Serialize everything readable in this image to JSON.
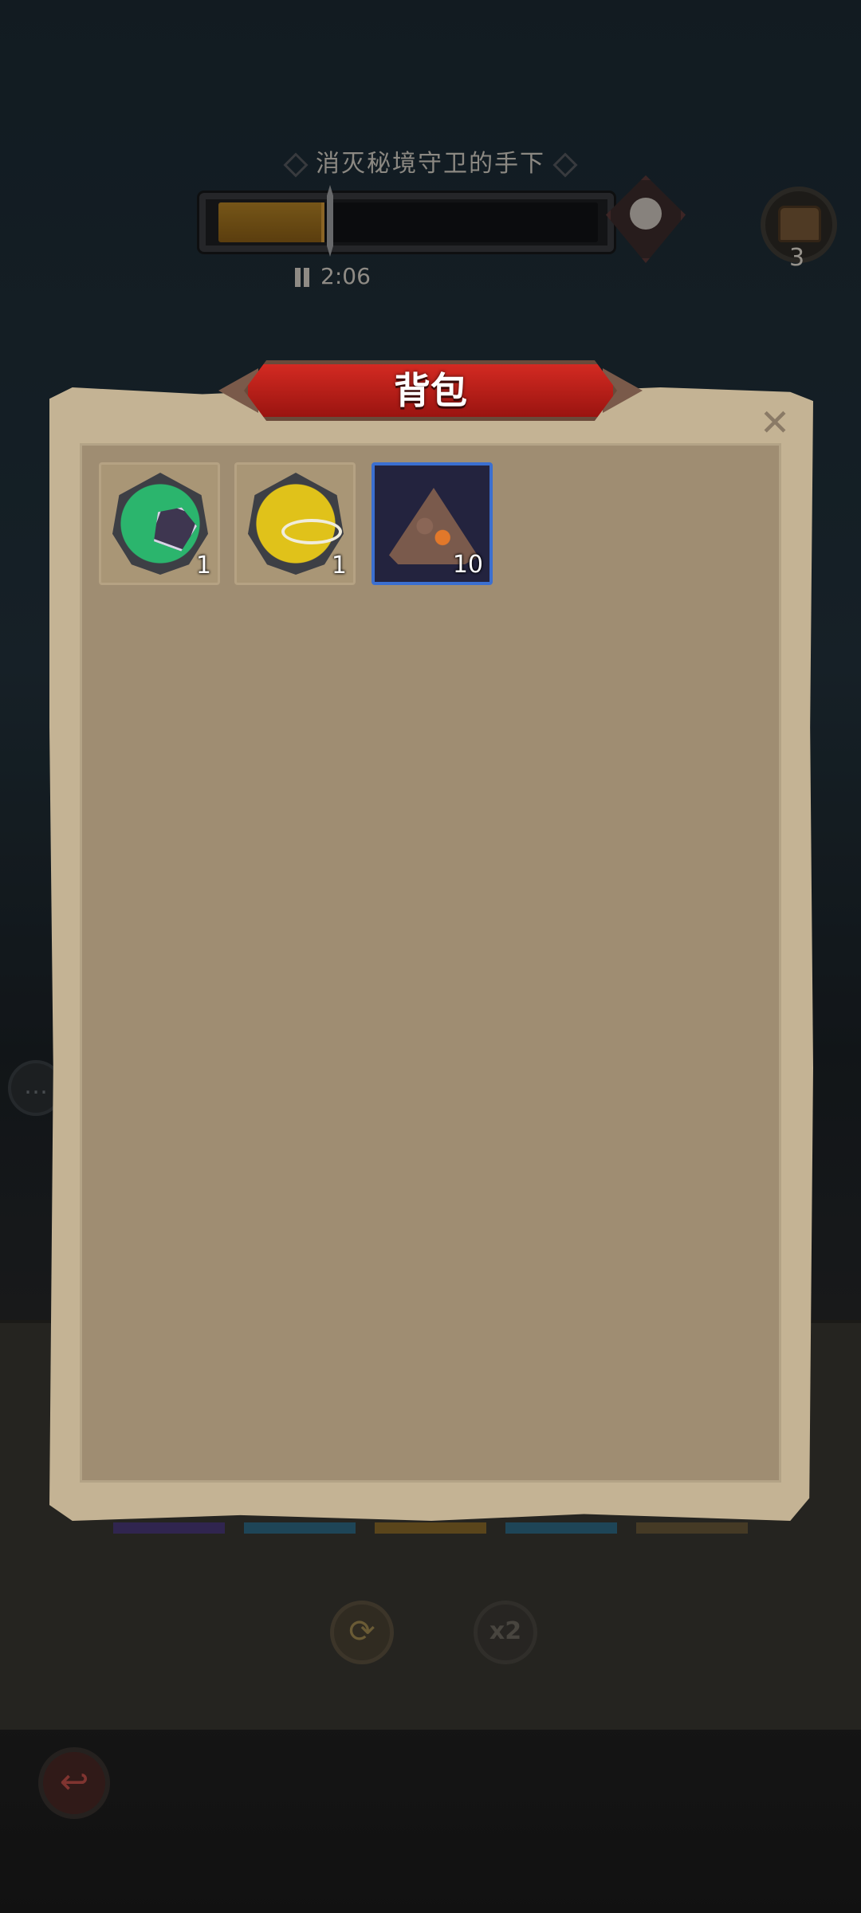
{
  "hud": {
    "objective": "消灭秘境守卫的手下",
    "progress": 0.27,
    "timer": "2:06",
    "chest_count": "3"
  },
  "game_controls": {
    "refresh_icon": "refresh-icon",
    "speed_label": "x2",
    "back_icon": "back-arrow-icon",
    "chat_icon": "chat-bubble-icon"
  },
  "backpack": {
    "title": "背包",
    "close_label": "✕",
    "items": [
      {
        "icon": "green-medal-gem-icon",
        "count": "1"
      },
      {
        "icon": "yellow-medal-whip-icon",
        "count": "1"
      },
      {
        "icon": "volcanic-ore-icon",
        "count": "10",
        "selected": true
      }
    ]
  },
  "colors": {
    "banner_red": "#c21e18",
    "selected_border": "#3b6fd0",
    "progress_fill": "#b58426"
  }
}
